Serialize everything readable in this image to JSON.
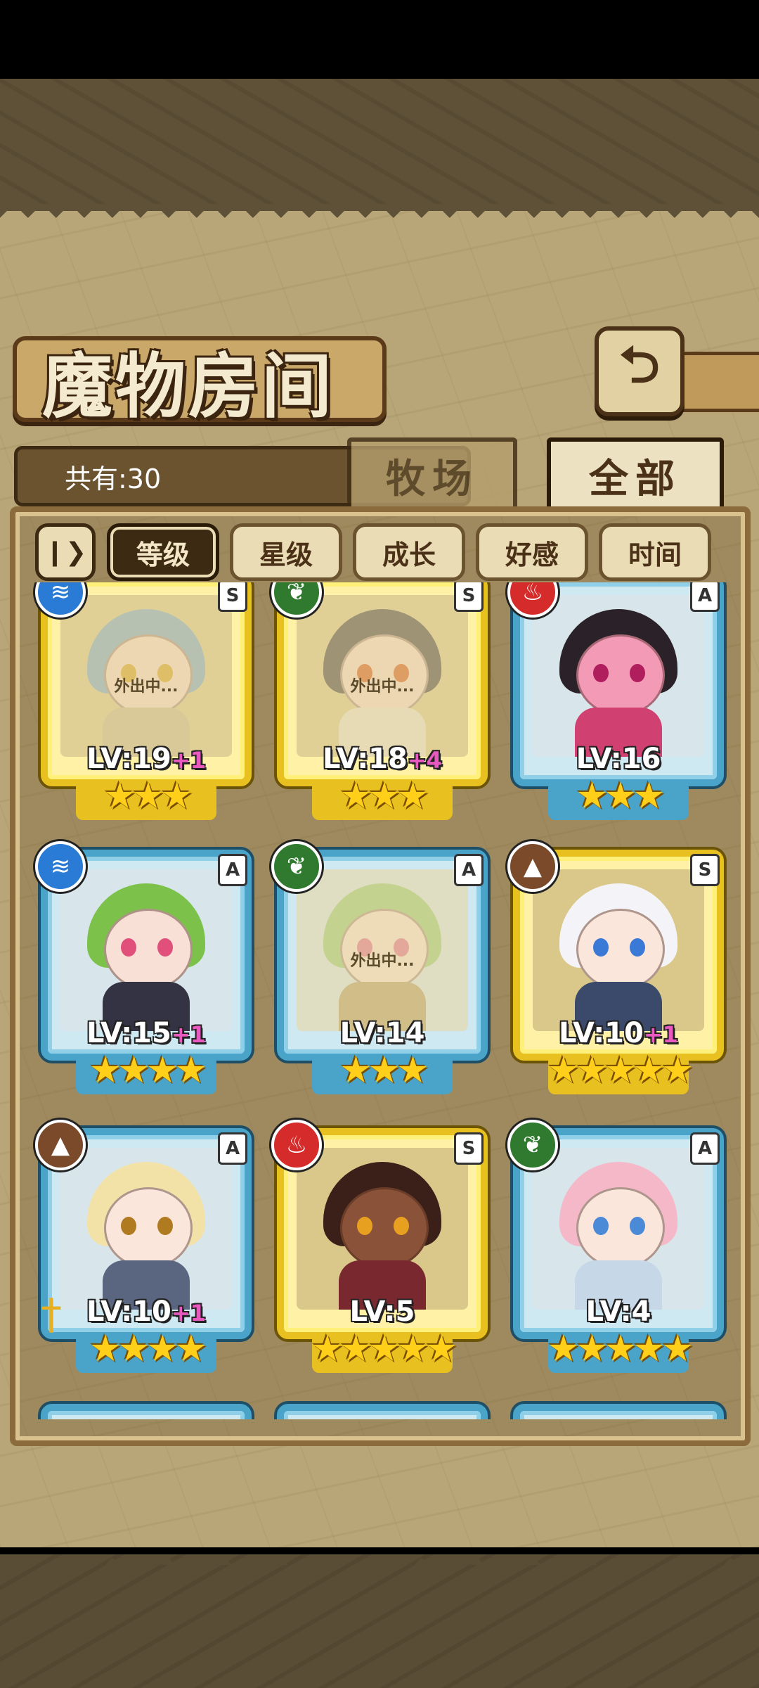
{
  "header": {
    "title": "魔物房间",
    "back_icon": "back-arrow-icon"
  },
  "count": {
    "label": "共有:30"
  },
  "tabs": [
    {
      "label": "牧场",
      "active": false
    },
    {
      "label": "全部",
      "active": true
    }
  ],
  "filters": {
    "pause_icon": "pause-icon",
    "items": [
      {
        "label": "等级",
        "active": true
      },
      {
        "label": "星级",
        "active": false
      },
      {
        "label": "成长",
        "active": false
      },
      {
        "label": "好感",
        "active": false
      },
      {
        "label": "时间",
        "active": false
      }
    ]
  },
  "cards": [
    {
      "element": "water",
      "rarity": "S",
      "level": "LV:19",
      "plus": "+1",
      "stars": "★★★",
      "away": "外出中...",
      "hair": "#7fa6c8",
      "skin": "#f6d8c8",
      "eye": "#d6a020",
      "body": "#c9b98f"
    },
    {
      "element": "wood",
      "rarity": "S",
      "level": "LV:18",
      "plus": "+4",
      "stars": "★★★",
      "away": "外出中...",
      "hair": "#4a4040",
      "skin": "#f6d8c8",
      "eye": "#d65a1a",
      "body": "#e8e0d0"
    },
    {
      "element": "fire",
      "rarity": "A",
      "level": "LV:16",
      "plus": "",
      "stars": "★★★",
      "away": "",
      "hair": "#2a2228",
      "skin": "#f29ab6",
      "eye": "#b01e5e",
      "body": "#d04070"
    },
    {
      "element": "water",
      "rarity": "A",
      "level": "LV:15",
      "plus": "+1",
      "stars": "★★★★",
      "away": "",
      "hair": "#7cc24a",
      "skin": "#f9e0d6",
      "eye": "#e0507a",
      "body": "#333344"
    },
    {
      "element": "wood",
      "rarity": "A",
      "level": "LV:14",
      "plus": "",
      "stars": "★★★",
      "away": "外出中...",
      "hair": "#9ccc7a",
      "skin": "#f9e0d6",
      "eye": "#e07090",
      "body": "#b59e6c"
    },
    {
      "element": "earth",
      "rarity": "S",
      "level": "LV:10",
      "plus": "+1",
      "stars": "★★★★★",
      "away": "",
      "hair": "#f4f4f8",
      "skin": "#fbe6dc",
      "eye": "#3a7ad6",
      "body": "#3b4a6a"
    },
    {
      "element": "earth",
      "rarity": "A",
      "level": "LV:10",
      "plus": "+1",
      "stars": "★★★★",
      "away": "",
      "hair": "#f3e2a8",
      "skin": "#fbe6dc",
      "eye": "#b07a20",
      "body": "#5a6680"
    },
    {
      "element": "fire",
      "rarity": "S",
      "level": "LV:5",
      "plus": "",
      "stars": "★★★★★",
      "away": "",
      "hair": "#3a2018",
      "skin": "#8a5238",
      "eye": "#e8a020",
      "body": "#7a2830"
    },
    {
      "element": "wood",
      "rarity": "A",
      "level": "LV:4",
      "plus": "",
      "stars": "★★★★★",
      "away": "",
      "hair": "#f4b8c8",
      "skin": "#fbe6dc",
      "eye": "#4a8ad6",
      "body": "#c6d8e8"
    }
  ]
}
